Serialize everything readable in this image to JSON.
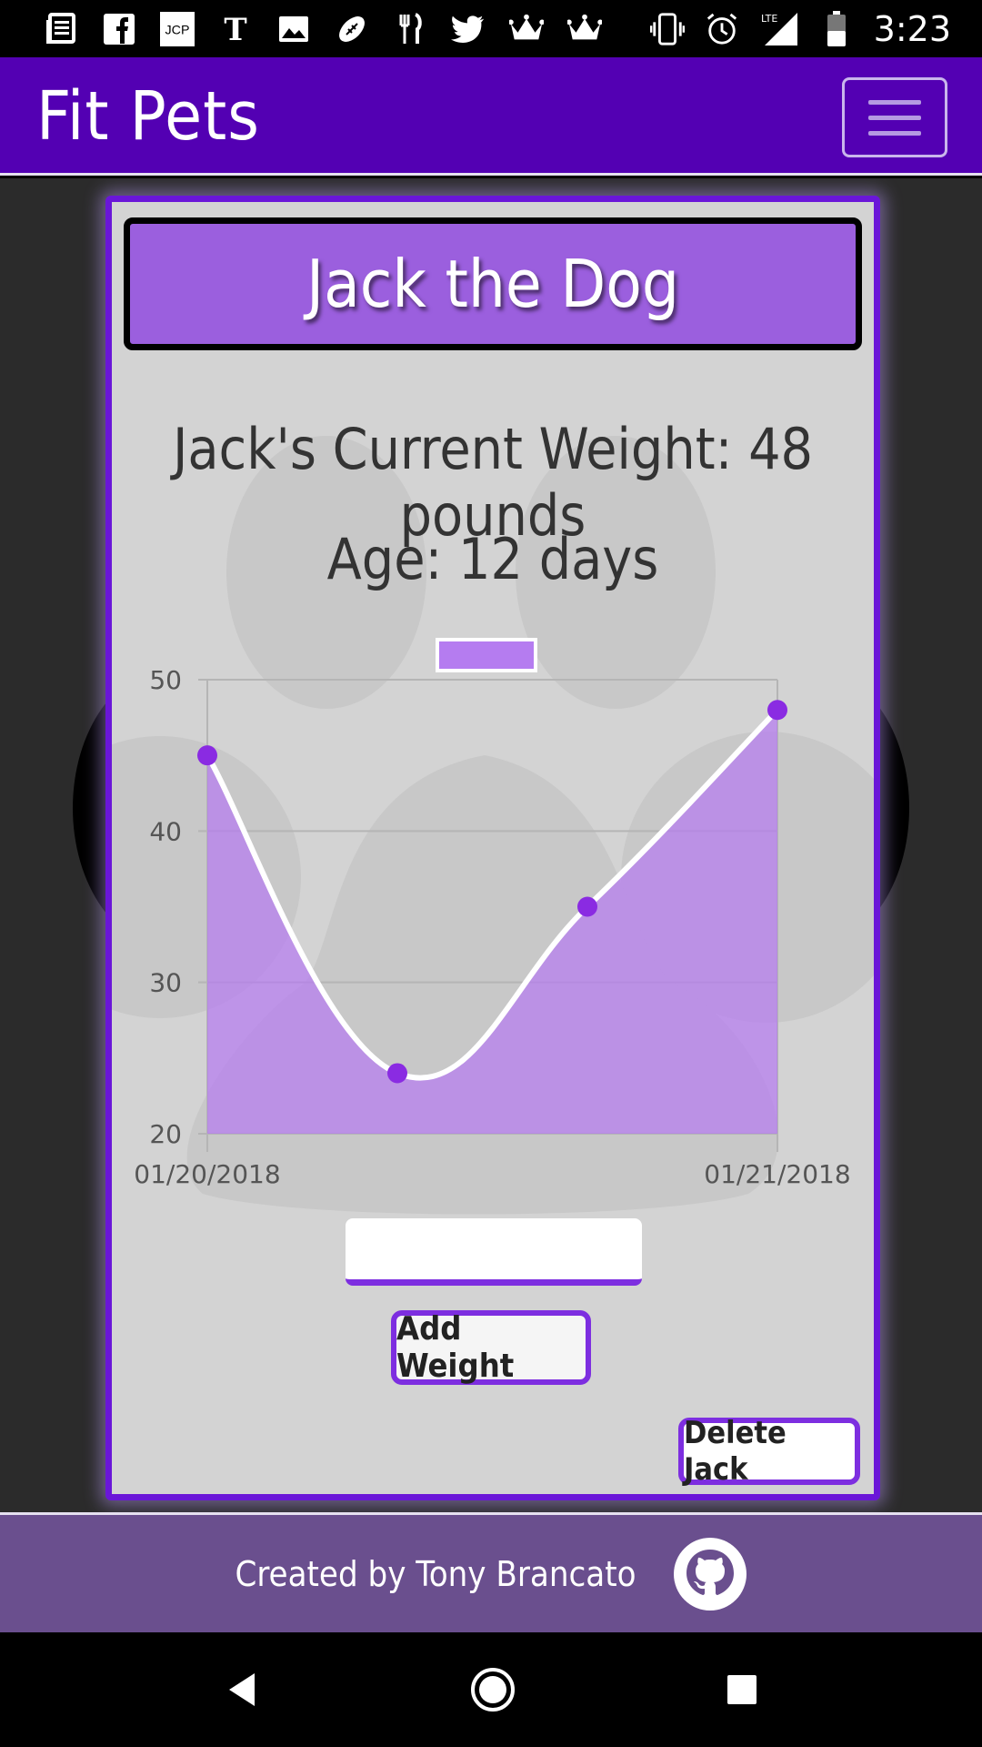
{
  "status_bar": {
    "time": "3:23",
    "network": "LTE",
    "notification_icons": [
      "news-icon",
      "facebook-icon",
      "jcp-icon",
      "nytimes-icon",
      "image-icon",
      "football-icon",
      "restaurant-icon",
      "twitter-icon",
      "crown-icon",
      "crown-icon"
    ],
    "jcp_label": "JCP"
  },
  "header": {
    "brand": "Fit Pets",
    "menu_icon": "hamburger-icon"
  },
  "pet": {
    "title": "Jack the Dog",
    "current_weight": "Jack's Current Weight: 48 pounds",
    "age": "Age: 12 days"
  },
  "chart_data": {
    "type": "area",
    "title": "",
    "xlabel": "",
    "ylabel": "",
    "x_tick_labels": [
      "01/20/2018",
      "01/21/2018"
    ],
    "y_tick_labels": [
      "50",
      "40",
      "30",
      "20"
    ],
    "ylim": [
      20,
      50
    ],
    "x": [
      0,
      1,
      2,
      3
    ],
    "values": [
      45,
      24,
      35,
      48
    ],
    "grid": true,
    "legend": "top-center",
    "colors": {
      "fill": "#b57cf0",
      "line": "#ffffff",
      "point": "#8a2be2"
    }
  },
  "form": {
    "weight_value": "",
    "add_label": "Add Weight",
    "delete_label": "Delete Jack"
  },
  "footer": {
    "credit": "Created by Tony Brancato",
    "icon": "github-icon"
  },
  "system_nav": [
    "back-icon",
    "home-icon",
    "recents-icon"
  ]
}
